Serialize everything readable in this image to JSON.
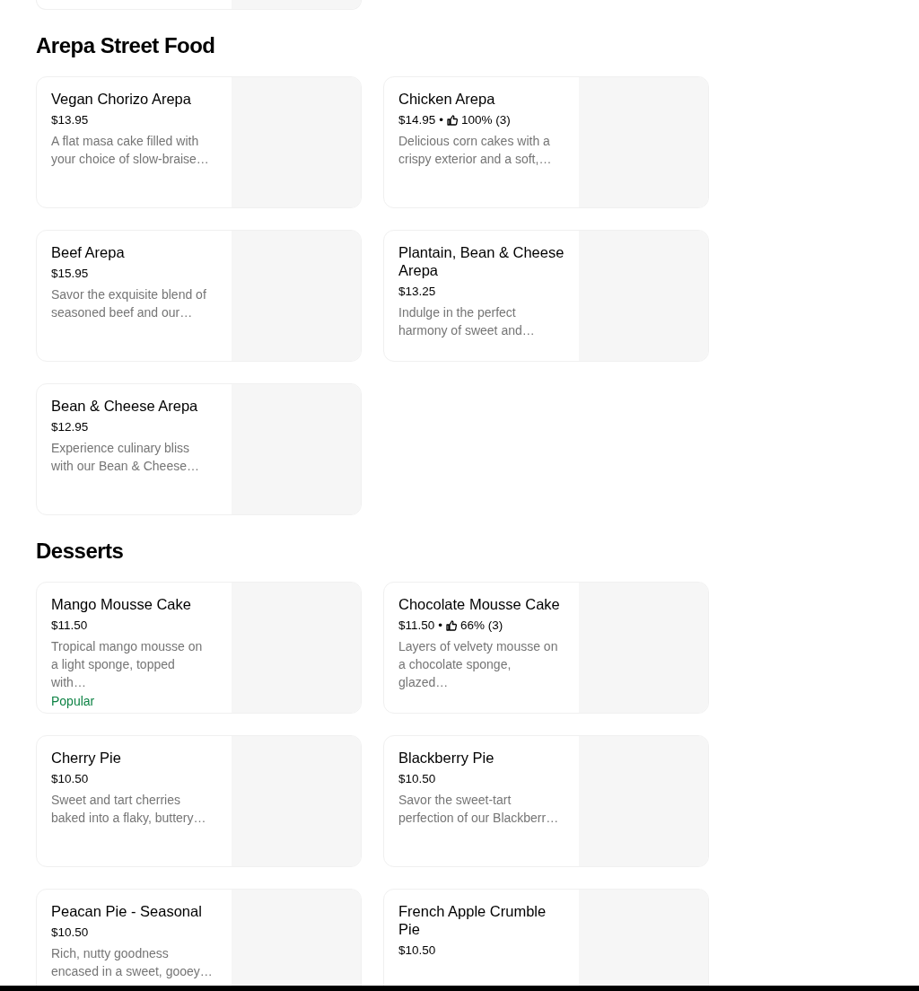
{
  "sections": [
    {
      "title": "Arepa Street Food",
      "items": [
        {
          "name": "Vegan Chorizo Arepa",
          "price": "$13.95",
          "description": "A flat masa cake filled with your choice of slow-braise…"
        },
        {
          "name": "Chicken Arepa",
          "price": "$14.95",
          "separator": "•",
          "rating": "100% (3)",
          "description": "Delicious corn cakes with a crispy exterior and a soft,…"
        },
        {
          "name": "Beef Arepa",
          "price": "$15.95",
          "description": "Savor the exquisite blend of seasoned beef and our…"
        },
        {
          "name": "Plantain, Bean & Cheese Arepa",
          "price": "$13.25",
          "description": "Indulge in the perfect harmony of sweet and…"
        },
        {
          "name": "Bean & Cheese Arepa",
          "price": "$12.95",
          "description": "Experience culinary bliss with our Bean & Cheese…"
        }
      ]
    },
    {
      "title": "Desserts",
      "items": [
        {
          "name": "Mango Mousse Cake",
          "price": "$11.50",
          "description": "Tropical mango mousse on a light sponge, topped with…",
          "badge": "Popular"
        },
        {
          "name": "Chocolate Mousse Cake",
          "price": "$11.50",
          "separator": "•",
          "rating": "66% (3)",
          "description": "Layers of velvety mousse on a chocolate sponge, glazed…"
        },
        {
          "name": "Cherry Pie",
          "price": "$10.50",
          "description": "Sweet and tart cherries baked into a flaky, buttery…"
        },
        {
          "name": "Blackberry Pie",
          "price": "$10.50",
          "description": "Savor the sweet-tart perfection of our Blackberr…"
        },
        {
          "name": "Peacan Pie - Seasonal",
          "price": "$10.50",
          "description": "Rich, nutty goodness encased in a sweet, gooey…"
        },
        {
          "name": "French Apple Crumble Pie",
          "price": "$10.50"
        }
      ]
    }
  ]
}
